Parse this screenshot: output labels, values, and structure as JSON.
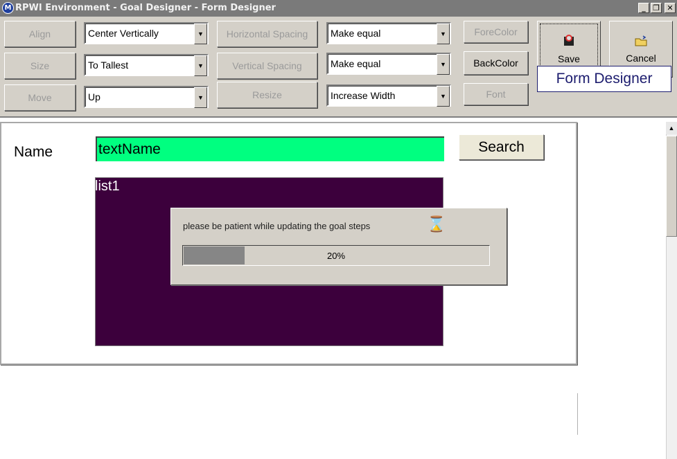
{
  "window": {
    "app_icon": "M",
    "title": "RPWI Environment - Goal Designer - Form Designer",
    "minimize": "_",
    "restore": "❐",
    "close": "✕"
  },
  "toolbar": {
    "align_label": "Align",
    "size_label": "Size",
    "move_label": "Move",
    "align_value": "Center Vertically",
    "size_value": "To Tallest",
    "move_value": "Up",
    "horizontal_spacing_label": "Horizontal Spacing",
    "vertical_spacing_label": "Vertical Spacing",
    "resize_label": "Resize",
    "horizontal_spacing_value": "Make equal",
    "vertical_spacing_value": "Make equal",
    "resize_value": "Increase Width",
    "forecolor_label": "ForeColor",
    "backcolor_label": "BackColor",
    "font_label": "Font",
    "save_label": "Save",
    "cancel_label": "Cancel",
    "form_designer_label": "Form Designer",
    "dropdown_arrow": "▼"
  },
  "form": {
    "name_label": "Name",
    "name_input_value": "textName",
    "search_label": "Search",
    "list_label": "list1"
  },
  "progress": {
    "message": "please be patient while updating the goal steps",
    "percent_text": "20%",
    "fraction": 0.2,
    "hourglass_icon": "⌛"
  },
  "scrollbar": {
    "up_arrow": "▲"
  },
  "colors": {
    "name_input_bg": "#00ff80",
    "list_bg": "#3c003c",
    "title_bar": "#7a7a7a",
    "label_border": "#1c1c6e"
  }
}
